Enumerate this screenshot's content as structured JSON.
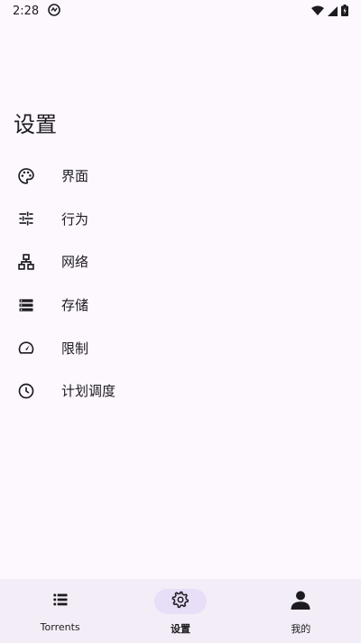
{
  "status_bar": {
    "time": "2:28"
  },
  "page": {
    "title": "设置"
  },
  "settings": {
    "items": [
      {
        "label": "界面",
        "icon": "palette-icon"
      },
      {
        "label": "行为",
        "icon": "tune-icon"
      },
      {
        "label": "网络",
        "icon": "network-icon"
      },
      {
        "label": "存储",
        "icon": "storage-icon"
      },
      {
        "label": "限制",
        "icon": "speed-icon"
      },
      {
        "label": "计划调度",
        "icon": "schedule-icon"
      }
    ]
  },
  "bottom_nav": {
    "items": [
      {
        "label": "Torrents",
        "icon": "list-icon"
      },
      {
        "label": "设置",
        "icon": "gear-icon",
        "active": true
      },
      {
        "label": "我的",
        "icon": "person-icon"
      }
    ]
  },
  "colors": {
    "background": "#fdf7fe",
    "nav_background": "#f3edf7",
    "active_indicator": "#e8def8",
    "text": "#1d1b20"
  }
}
